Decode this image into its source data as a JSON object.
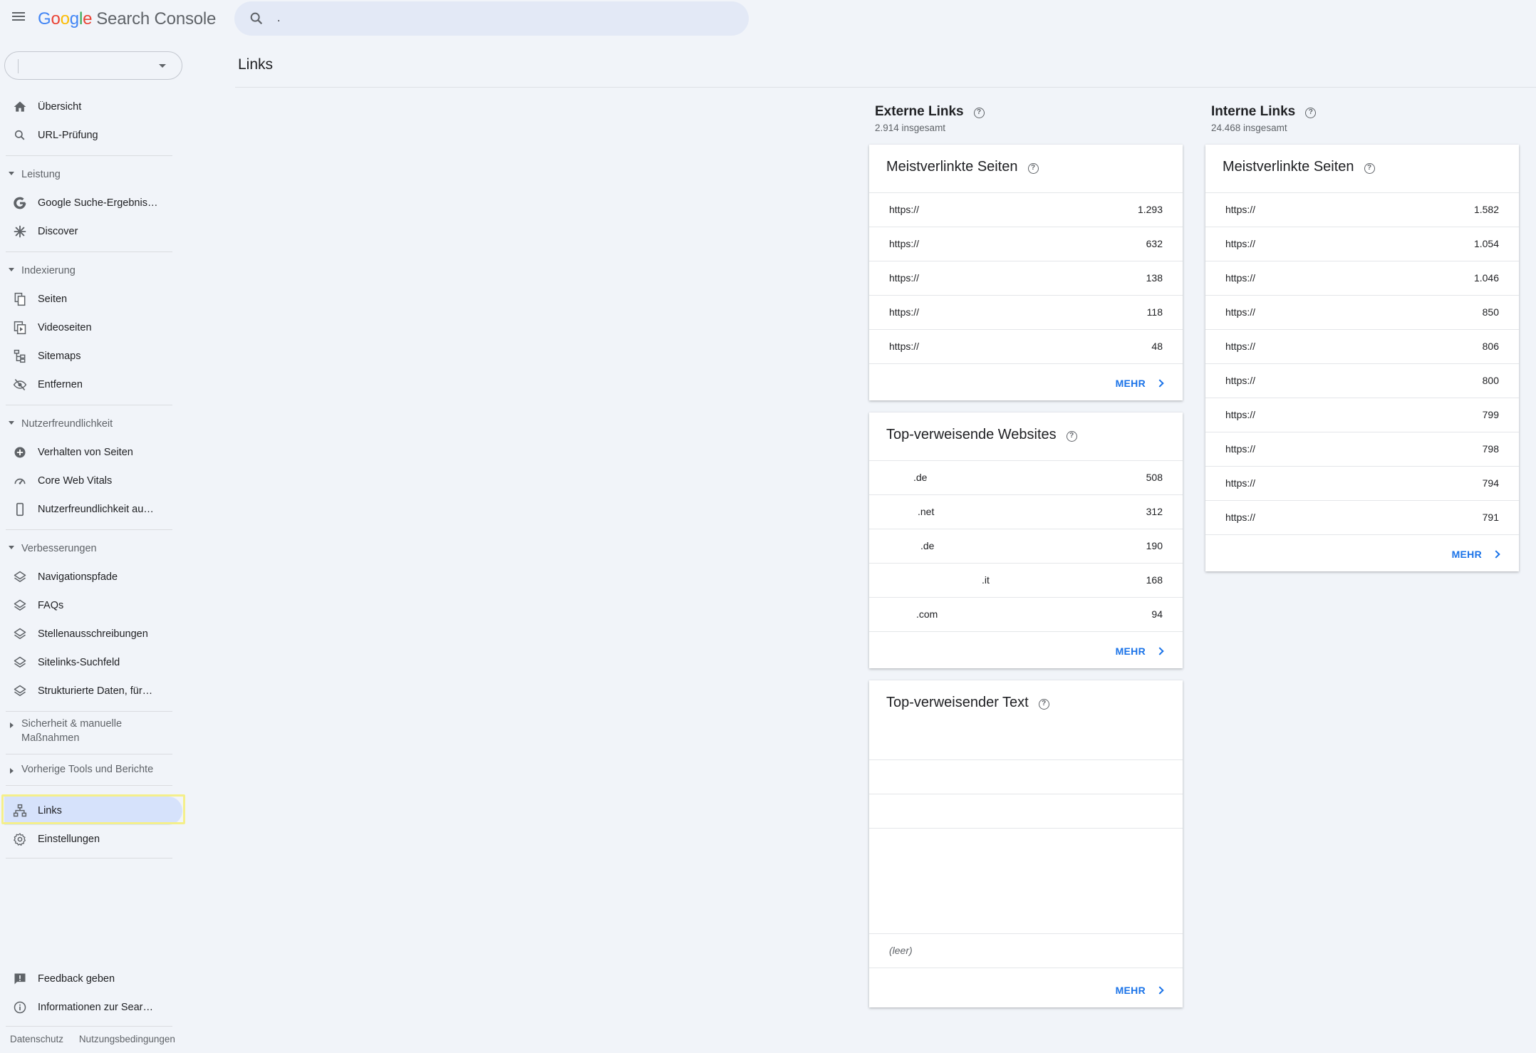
{
  "app": {
    "logo_google": [
      "G",
      "o",
      "o",
      "g",
      "l",
      "e"
    ],
    "logo_product": "Search Console",
    "search_value": "."
  },
  "sidebar": {
    "property_value": "",
    "items": [
      {
        "label": "Übersicht",
        "icon": "home-icon"
      },
      {
        "label": "URL-Prüfung",
        "icon": "search-icon"
      }
    ],
    "sections": [
      {
        "label": "Leistung",
        "items": [
          {
            "label": "Google Suche-Ergebnis…",
            "icon": "google-g-icon"
          },
          {
            "label": "Discover",
            "icon": "asterisk-icon"
          }
        ]
      },
      {
        "label": "Indexierung",
        "items": [
          {
            "label": "Seiten",
            "icon": "pages-icon"
          },
          {
            "label": "Videoseiten",
            "icon": "video-pages-icon"
          },
          {
            "label": "Sitemaps",
            "icon": "sitemap-icon"
          },
          {
            "label": "Entfernen",
            "icon": "eye-off-icon"
          }
        ]
      },
      {
        "label": "Nutzerfreundlichkeit",
        "items": [
          {
            "label": "Verhalten von Seiten",
            "icon": "plus-circle-icon"
          },
          {
            "label": "Core Web Vitals",
            "icon": "gauge-icon"
          },
          {
            "label": "Nutzerfreundlichkeit au…",
            "icon": "mobile-icon"
          }
        ]
      },
      {
        "label": "Verbesserungen",
        "items": [
          {
            "label": "Navigationspfade",
            "icon": "layers-icon"
          },
          {
            "label": "FAQs",
            "icon": "layers-icon"
          },
          {
            "label": "Stellenausschreibungen",
            "icon": "layers-icon"
          },
          {
            "label": "Sitelinks-Suchfeld",
            "icon": "layers-icon"
          },
          {
            "label": "Strukturierte Daten, für…",
            "icon": "layers-icon"
          }
        ]
      },
      {
        "label": "Sicherheit & manuelle Maßnahmen",
        "items": []
      },
      {
        "label": "Vorherige Tools und Berichte",
        "items": []
      }
    ],
    "bottom_items": [
      {
        "label": "Links",
        "icon": "links-tree-icon",
        "active": true
      },
      {
        "label": "Einstellungen",
        "icon": "gear-icon"
      }
    ],
    "footer_items": [
      {
        "label": "Feedback geben",
        "icon": "feedback-icon"
      },
      {
        "label": "Informationen zur Sear…",
        "icon": "info-icon"
      }
    ],
    "footer_links": [
      "Datenschutz",
      "Nutzungsbedingungen"
    ]
  },
  "main": {
    "page_title": "Links",
    "external": {
      "heading": "Externe Links",
      "total": "2.914 insgesamt",
      "top_pages": {
        "title": "Meistverlinkte Seiten",
        "rows": [
          {
            "url": "https://",
            "count": "1.293"
          },
          {
            "url": "https://",
            "count": "632"
          },
          {
            "url": "https://",
            "count": "138"
          },
          {
            "url": "https://",
            "count": "118"
          },
          {
            "url": "https://",
            "count": "48"
          }
        ],
        "more": "MEHR"
      },
      "top_sites": {
        "title": "Top-verweisende Websites",
        "rows": [
          {
            "site": ".de",
            "count": "508"
          },
          {
            "site": ".net",
            "count": "312"
          },
          {
            "site": ".de",
            "count": "190"
          },
          {
            "site": ".it",
            "count": "168"
          },
          {
            "site": ".com",
            "count": "94"
          }
        ],
        "more": "MEHR"
      },
      "top_text": {
        "title": "Top-verweisender Text",
        "empty_label": "(leer)",
        "more": "MEHR"
      }
    },
    "internal": {
      "heading": "Interne Links",
      "total": "24.468 insgesamt",
      "top_pages": {
        "title": "Meistverlinkte Seiten",
        "rows": [
          {
            "url": "https://",
            "count": "1.582"
          },
          {
            "url": "https://",
            "count": "1.054"
          },
          {
            "url": "https://",
            "count": "1.046"
          },
          {
            "url": "https://",
            "count": "850"
          },
          {
            "url": "https://",
            "count": "806"
          },
          {
            "url": "https://",
            "count": "800"
          },
          {
            "url": "https://",
            "count": "799"
          },
          {
            "url": "https://",
            "count": "798"
          },
          {
            "url": "https://",
            "count": "794"
          },
          {
            "url": "https://",
            "count": "791"
          }
        ],
        "more": "MEHR"
      }
    }
  },
  "colors": {
    "background": "#f1f4f9",
    "active_nav": "#d6e2fb",
    "link_blue": "#1a73e8",
    "highlight": "#f4ef8b"
  }
}
